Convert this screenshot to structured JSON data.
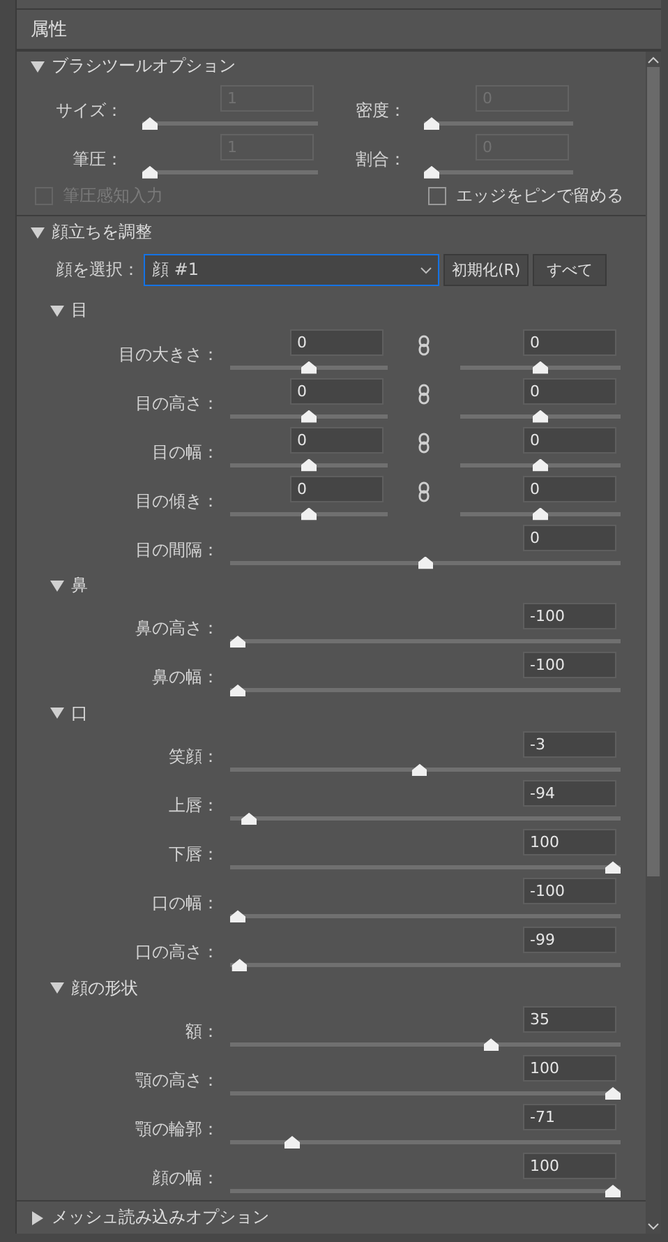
{
  "panel": {
    "title": "属性"
  },
  "brush_options": {
    "title": "ブラシツールオプション",
    "expanded": true,
    "rows": [
      [
        {
          "label": "サイズ：",
          "value": "1",
          "level": 0,
          "disabled": true
        },
        {
          "label": "密度：",
          "value": "0",
          "level": 0,
          "disabled": true
        }
      ],
      [
        {
          "label": "筆圧：",
          "value": "1",
          "level": 0,
          "disabled": true
        },
        {
          "label": "割合：",
          "value": "0",
          "level": 0,
          "disabled": true
        }
      ]
    ],
    "checkboxes": [
      {
        "label": "筆圧感知入力",
        "checked": false,
        "disabled": true
      },
      {
        "label": "エッジをピンで留める",
        "checked": false,
        "disabled": false
      }
    ]
  },
  "face_aware": {
    "title": "顔立ちを調整",
    "expanded": true,
    "face_select": {
      "label": "顔を選択：",
      "value": "顔 #1"
    },
    "buttons": [
      "初期化(R)",
      "すべて"
    ],
    "groups": [
      {
        "title": "目",
        "expanded": true,
        "rows": [
          {
            "kind": "pair",
            "label": "目の大きさ：",
            "left": {
              "value": "0",
              "level": 0.5
            },
            "right": {
              "value": "0",
              "level": 0.5
            }
          },
          {
            "kind": "pair",
            "label": "目の高さ：",
            "left": {
              "value": "0",
              "level": 0.5
            },
            "right": {
              "value": "0",
              "level": 0.5
            }
          },
          {
            "kind": "pair",
            "label": "目の幅：",
            "left": {
              "value": "0",
              "level": 0.5
            },
            "right": {
              "value": "0",
              "level": 0.5
            }
          },
          {
            "kind": "pair",
            "label": "目の傾き：",
            "left": {
              "value": "0",
              "level": 0.5
            },
            "right": {
              "value": "0",
              "level": 0.5
            }
          },
          {
            "kind": "single",
            "label": "目の間隔：",
            "value": "0",
            "level": 0.5
          }
        ]
      },
      {
        "title": "鼻",
        "expanded": true,
        "rows": [
          {
            "kind": "single",
            "label": "鼻の高さ：",
            "value": "-100",
            "level": 0
          },
          {
            "kind": "single",
            "label": "鼻の幅：",
            "value": "-100",
            "level": 0
          }
        ]
      },
      {
        "title": "口",
        "expanded": true,
        "rows": [
          {
            "kind": "single",
            "label": "笑顔：",
            "value": "-3",
            "level": 0.485
          },
          {
            "kind": "single",
            "label": "上唇：",
            "value": "-94",
            "level": 0.03
          },
          {
            "kind": "single",
            "label": "下唇：",
            "value": "100",
            "level": 1
          },
          {
            "kind": "single",
            "label": "口の幅：",
            "value": "-100",
            "level": 0
          },
          {
            "kind": "single",
            "label": "口の高さ：",
            "value": "-99",
            "level": 0.005
          }
        ]
      },
      {
        "title": "顔の形状",
        "expanded": true,
        "rows": [
          {
            "kind": "single",
            "label": "額：",
            "value": "35",
            "level": 0.675
          },
          {
            "kind": "single",
            "label": "顎の高さ：",
            "value": "100",
            "level": 1
          },
          {
            "kind": "single",
            "label": "顎の輪郭：",
            "value": "-71",
            "level": 0.145
          },
          {
            "kind": "single",
            "label": "顔の幅：",
            "value": "100",
            "level": 1
          }
        ]
      }
    ]
  },
  "mesh_options": {
    "title": "メッシュ読み込みオプション",
    "expanded": false
  }
}
